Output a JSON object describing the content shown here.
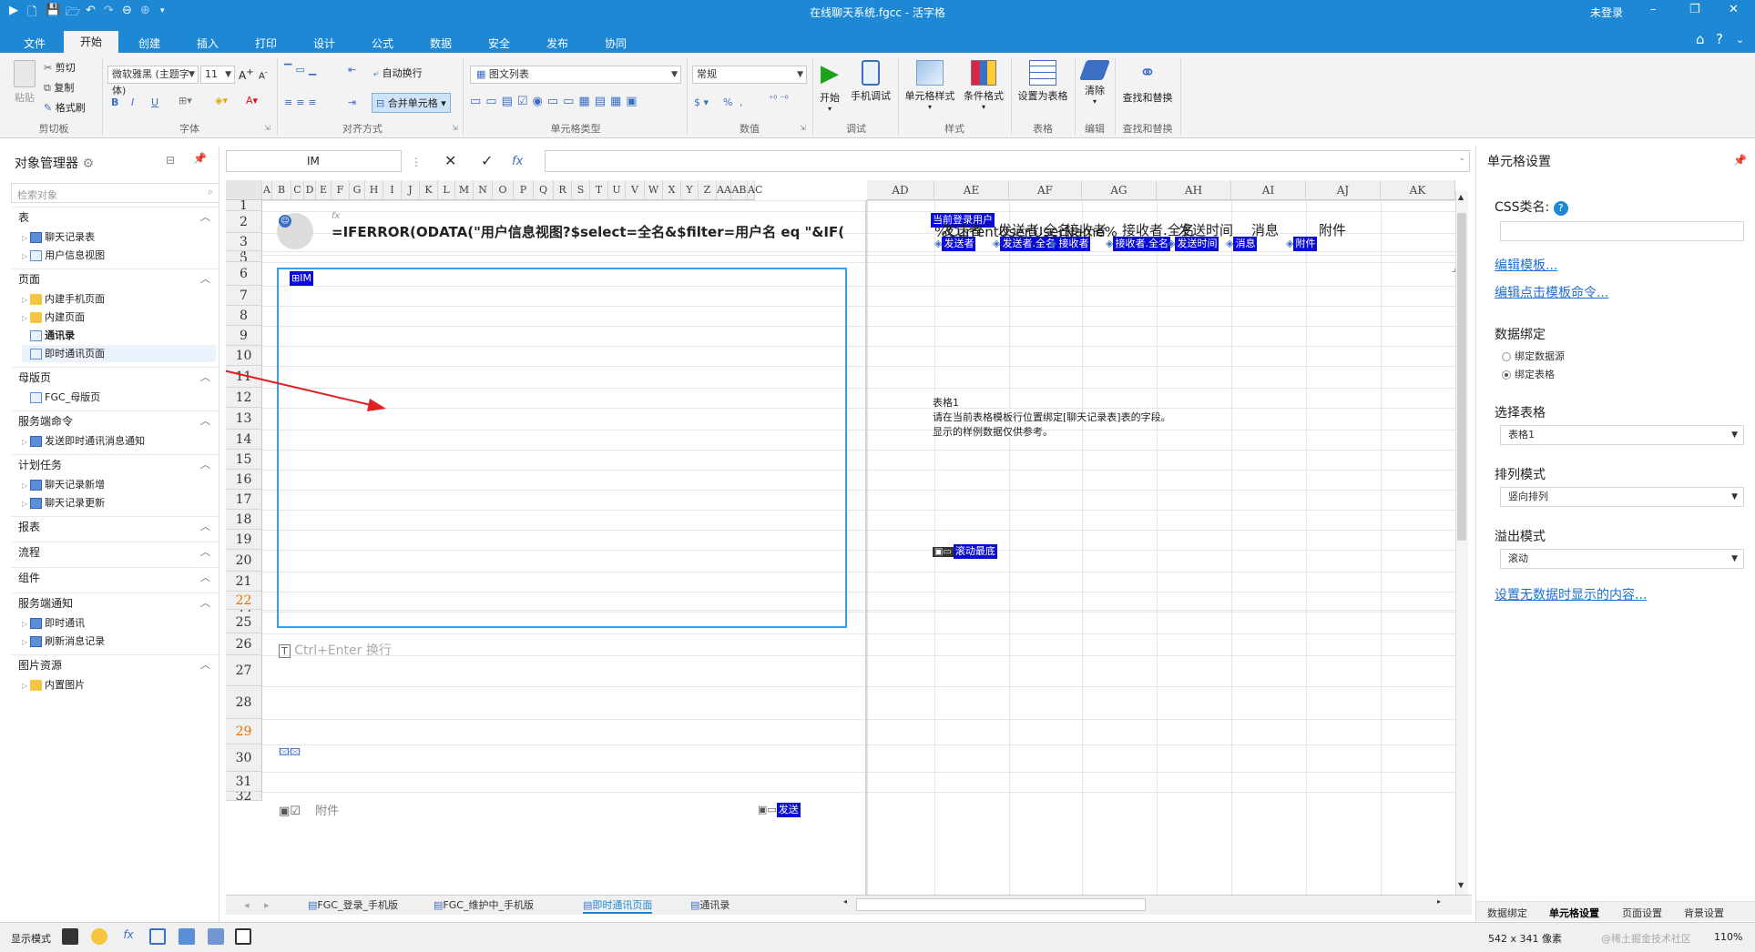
{
  "titlebar": {
    "title": "在线聊天系统.fgcc - 活字格",
    "login": "未登录",
    "min": "–",
    "restore": "❐",
    "close": "✕"
  },
  "menu": {
    "tabs": [
      "文件",
      "开始",
      "创建",
      "插入",
      "打印",
      "设计",
      "公式",
      "数据",
      "安全",
      "发布",
      "协同"
    ],
    "active": "开始"
  },
  "ribbon": {
    "clipboard": {
      "paste": "粘贴",
      "cut": "剪切",
      "copy": "复制",
      "format_painter": "格式刷",
      "group": "剪切板"
    },
    "font": {
      "family": "微软雅黑 (主题字体)",
      "size": "11",
      "group": "字体",
      "bold": "B",
      "italic": "I",
      "underline": "U"
    },
    "align": {
      "wrap": "自动换行",
      "merge": "合并单元格",
      "group": "对齐方式"
    },
    "celltype": {
      "value": "图文列表",
      "group": "单元格类型"
    },
    "number": {
      "value": "常规",
      "group": "数值",
      "currency": "$",
      "percent": "%"
    },
    "debug": {
      "start": "开始",
      "mobile": "手机调试",
      "group": "调试"
    },
    "style": {
      "cell_style": "单元格样式",
      "cond_format": "条件格式",
      "group": "样式"
    },
    "table": {
      "set_table": "设置为表格",
      "group": "表格"
    },
    "edit": {
      "clear": "清除",
      "group": "编辑"
    },
    "find": {
      "find_replace": "查找和替换",
      "group": "查找和替换"
    }
  },
  "leftpanel": {
    "title": "对象管理器",
    "search_placeholder": "检索对象",
    "sections": [
      {
        "label": "表",
        "items": [
          "聊天记录表",
          "用户信息视图"
        ]
      },
      {
        "label": "页面",
        "items": [
          "内建手机页面",
          "内建页面",
          "通讯录",
          "即时通讯页面"
        ]
      },
      {
        "label": "母版页",
        "items": [
          "FGC_母版页"
        ]
      },
      {
        "label": "服务端命令",
        "items": [
          "发送即时通讯消息通知"
        ]
      },
      {
        "label": "计划任务",
        "items": [
          "聊天记录新增",
          "聊天记录更新"
        ]
      },
      {
        "label": "报表",
        "items": []
      },
      {
        "label": "流程",
        "items": []
      },
      {
        "label": "组件",
        "items": []
      },
      {
        "label": "服务端通知",
        "items": [
          "即时通讯",
          "刷新消息记录"
        ]
      },
      {
        "label": "图片资源",
        "items": [
          "内置图片"
        ]
      }
    ]
  },
  "formulabar": {
    "name_box": "IM",
    "cancel": "✕",
    "confirm": "✓",
    "fx": "fx"
  },
  "sheet": {
    "columns_left": [
      "A",
      "B",
      "C",
      "D",
      "E",
      "F",
      "G",
      "H",
      "I",
      "J",
      "K",
      "L",
      "M",
      "N",
      "O",
      "P",
      "Q",
      "R",
      "S",
      "T",
      "U",
      "V",
      "W",
      "X",
      "Y",
      "Z",
      "AA",
      "AB",
      "AC"
    ],
    "columns_right": [
      "AD",
      "AE",
      "AF",
      "AG",
      "AH",
      "AI",
      "AJ",
      "AK"
    ],
    "rows": [
      "1",
      "2",
      "3",
      "4",
      "5",
      "6",
      "7",
      "8",
      "9",
      "10",
      "11",
      "12",
      "13",
      "14",
      "15",
      "16",
      "17",
      "18",
      "19",
      "20",
      "21",
      "22",
      "23",
      "25",
      "26",
      "27",
      "28",
      "29",
      "30",
      "31",
      "32"
    ],
    "formula_text": "=IFERROR(ODATA(\"用户信息视图?$select=全名&$filter=用户名 eq \"&IF(",
    "fx_mark": "fx",
    "im_tag": "IM",
    "current_user_tag": "当前登录用户",
    "current_user_value": "%CurrentUser.UserName%",
    "table_headers": [
      "发送者",
      "发送者.全名",
      "接收者",
      "接收者.全名",
      "发送时间",
      "消息",
      "附件"
    ],
    "table_tags": [
      "发送者",
      "发送者.全名",
      "接收者",
      "接收者.全名",
      "发送时间",
      "消息",
      "附件"
    ],
    "table_note": [
      "表格1",
      "请在当前表格模板行位置绑定[聊天记录表]表的字段。",
      "显示的样例数据仅供参考。"
    ],
    "scroll_bottom_tag": "滚动最底",
    "input_placeholder": "Ctrl+Enter 换行",
    "attachment_label": "附件",
    "send_tag": "发送"
  },
  "sheettabs": {
    "tabs": [
      "FGC_登录_手机版",
      "FGC_维护中_手机版",
      "即时通讯页面",
      "通讯录"
    ],
    "active": "即时通讯页面"
  },
  "rightpanel": {
    "title": "单元格设置",
    "css_label": "CSS类名:",
    "edit_template": "编辑模板...",
    "edit_click_cmd": "编辑点击模板命令...",
    "binding_label": "数据绑定",
    "bind_datasource": "绑定数据源",
    "bind_table": "绑定表格",
    "select_table_label": "选择表格",
    "select_table_value": "表格1",
    "arrange_label": "排列模式",
    "arrange_value": "竖向排列",
    "overflow_label": "溢出模式",
    "overflow_value": "滚动",
    "empty_link": "设置无数据时显示的内容...",
    "tabs": [
      "数据绑定",
      "单元格设置",
      "页面设置",
      "背景设置"
    ]
  },
  "statusbar": {
    "mode": "显示模式",
    "size": "542 x 341 像素",
    "zoom": "110%",
    "watermark": "@稀土掘金技术社区"
  },
  "colors": {
    "accent": "#1e88d5",
    "tag_blue": "#0b0bd8",
    "selection_border": "#3aa0e8",
    "arrow": "#e02020"
  }
}
